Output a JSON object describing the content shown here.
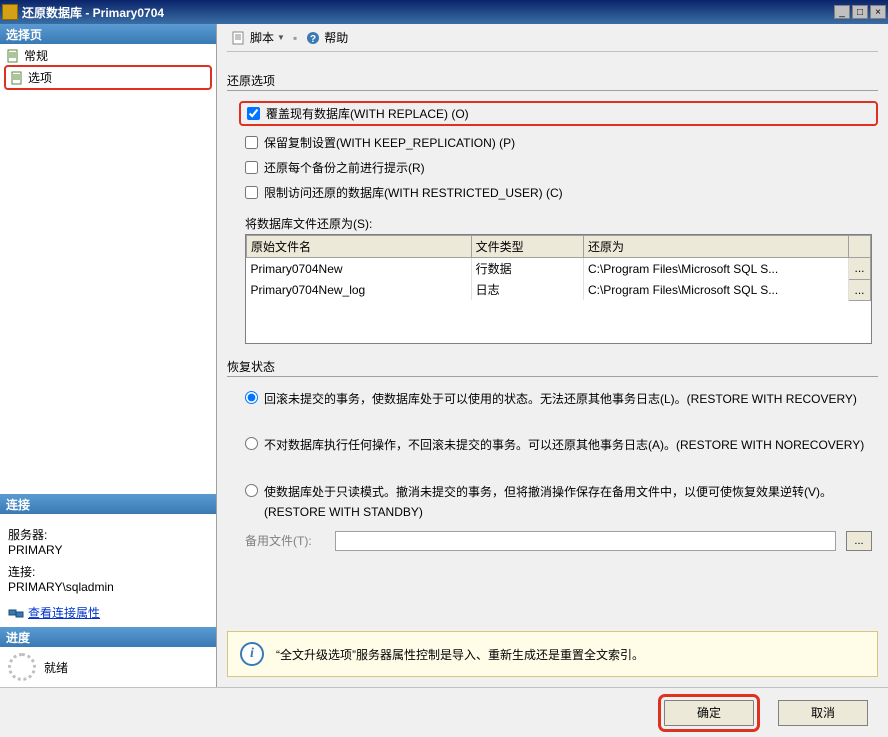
{
  "window": {
    "title": "还原数据库 - Primary0704"
  },
  "left": {
    "section_select": "选择页",
    "nav_general": "常规",
    "nav_options": "选项",
    "section_conn": "连接",
    "server_label": "服务器:",
    "server_value": "PRIMARY",
    "conn_label": "连接:",
    "conn_value": "PRIMARY\\sqladmin",
    "view_conn_props": "查看连接属性",
    "section_progress": "进度",
    "progress_status": "就绪"
  },
  "toolbar": {
    "script": "脚本",
    "help": "帮助"
  },
  "restore_options": {
    "title": "还原选项",
    "cb_replace": "覆盖现有数据库(WITH REPLACE) (O)",
    "cb_keep_replication": "保留复制设置(WITH KEEP_REPLICATION) (P)",
    "cb_prompt": "还原每个备份之前进行提示(R)",
    "cb_restricted": "限制访问还原的数据库(WITH RESTRICTED_USER) (C)",
    "restore_as_label": "将数据库文件还原为(S):",
    "table": {
      "headers": {
        "orig": "原始文件名",
        "type": "文件类型",
        "as": "还原为"
      },
      "rows": [
        {
          "orig": "Primary0704New",
          "type": "行数据",
          "as": "C:\\Program Files\\Microsoft SQL S...",
          "btn": "..."
        },
        {
          "orig": "Primary0704New_log",
          "type": "日志",
          "as": "C:\\Program Files\\Microsoft SQL S...",
          "btn": "..."
        }
      ]
    }
  },
  "recovery": {
    "title": "恢复状态",
    "r_recovery": "回滚未提交的事务，使数据库处于可以使用的状态。无法还原其他事务日志(L)。(RESTORE WITH RECOVERY)",
    "r_norecovery": "不对数据库执行任何操作，不回滚未提交的事务。可以还原其他事务日志(A)。(RESTORE WITH NORECOVERY)",
    "r_standby": "使数据库处于只读模式。撤消未提交的事务，但将撤消操作保存在备用文件中，以便可使恢复效果逆转(V)。(RESTORE WITH STANDBY)",
    "standby_file_label": "备用文件(T):",
    "browse": "..."
  },
  "info": {
    "text": "“全文升级选项”服务器属性控制是导入、重新生成还是重置全文索引。"
  },
  "footer": {
    "ok": "确定",
    "cancel": "取消"
  }
}
